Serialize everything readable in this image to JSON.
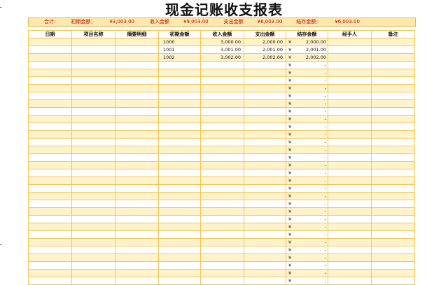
{
  "title": "现金记账收支报表",
  "summary": {
    "total_label": "合计:",
    "opening_label": "初期金额：",
    "opening_value": "¥3,003.00",
    "income_label": "收入金额",
    "income_value": "¥9,003.00",
    "expense_label": "支出金额",
    "expense_value": "¥6,003.00",
    "balance_label": "结存金额：",
    "balance_value": "¥6,003.00"
  },
  "table": {
    "headers": [
      "日期",
      "项目名称",
      "摘要明细",
      "初期金额",
      "收入金额",
      "支出金额",
      "结存金额",
      "经手人",
      "备注"
    ],
    "rows": [
      {
        "date": "",
        "item": "",
        "summary": "",
        "opening": "1000",
        "income": "3,000.00",
        "expense": "2,000.00",
        "balance_symbol": "¥",
        "balance": "2,000.00",
        "handler": "",
        "note": ""
      },
      {
        "date": "",
        "item": "",
        "summary": "",
        "opening": "1001",
        "income": "3,001.00",
        "expense": "2,001.00",
        "balance_symbol": "¥",
        "balance": "2,001.00",
        "handler": "",
        "note": ""
      },
      {
        "date": "",
        "item": "",
        "summary": "",
        "opening": "1002",
        "income": "3,002.00",
        "expense": "2,002.00",
        "balance_symbol": "¥",
        "balance": "2,002.00",
        "handler": "",
        "note": ""
      }
    ],
    "blank_balance_symbol": "¥",
    "blank_balance_value": "-",
    "blank_row_count": 29
  }
}
